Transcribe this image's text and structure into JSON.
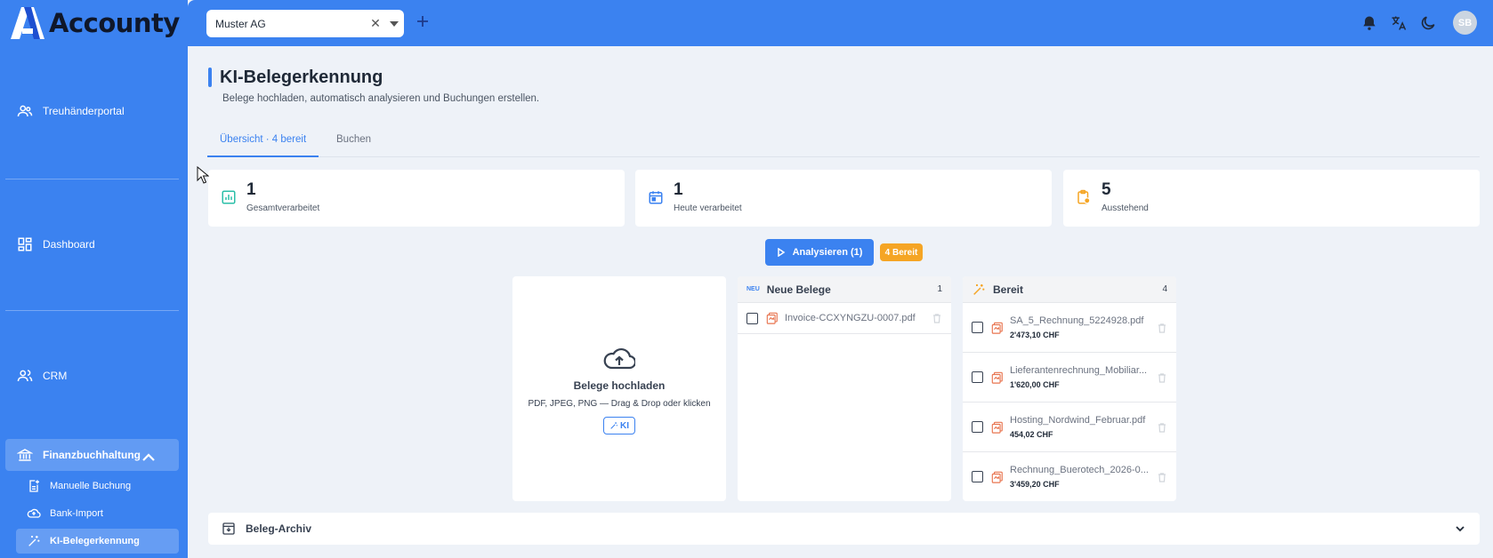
{
  "app": {
    "name": "Accounty"
  },
  "colors": {
    "primary": "#3b82f0",
    "accent_orange": "#f5a524",
    "file_icon": "#e8744f"
  },
  "sidebar": {
    "items": [
      {
        "label": "Treuhänderportal",
        "icon": "users-icon"
      },
      {
        "label": "Dashboard",
        "icon": "grid-icon"
      },
      {
        "label": "CRM",
        "icon": "contacts-icon"
      },
      {
        "label": "Finanzbuchhaltung",
        "icon": "bank-icon",
        "expanded": true
      }
    ],
    "subitems": [
      {
        "label": "Manuelle Buchung",
        "icon": "document-add-icon"
      },
      {
        "label": "Bank-Import",
        "icon": "cloud-upload-icon"
      },
      {
        "label": "KI-Belegerkennung",
        "icon": "magic-wand-icon",
        "active": true
      }
    ]
  },
  "topbar": {
    "company_select": {
      "value": "Muster AG"
    },
    "avatar_initials": "SB"
  },
  "page": {
    "title": "KI-Belegerkennung",
    "subtitle": "Belege hochladen, automatisch analysieren und Buchungen erstellen.",
    "tabs": [
      {
        "label": "Übersicht · 4 bereit",
        "active": true
      },
      {
        "label": "Buchen",
        "active": false
      }
    ]
  },
  "stats": [
    {
      "value": "1",
      "label": "Gesamtverarbeitet",
      "icon": "chart-icon"
    },
    {
      "value": "1",
      "label": "Heute verarbeitet",
      "icon": "calendar-icon"
    },
    {
      "value": "5",
      "label": "Ausstehend",
      "icon": "clipboard-pending-icon"
    }
  ],
  "actions": {
    "analyze_label": "Analysieren (1)",
    "ready_badge": "4 Bereit"
  },
  "upload": {
    "title": "Belege hochladen",
    "hint": "PDF, JPEG, PNG — Drag & Drop oder klicken",
    "chip": "KI"
  },
  "new_docs": {
    "tag": "NEU",
    "title": "Neue Belege",
    "count": "1",
    "files": [
      {
        "name": "Invoice-CCXYNGZU-0007.pdf"
      }
    ]
  },
  "ready_docs": {
    "title": "Bereit",
    "count": "4",
    "files": [
      {
        "name": "SA_5_Rechnung_5224928.pdf",
        "amount": "2'473,10 CHF"
      },
      {
        "name": "Lieferantenrechnung_Mobiliar...",
        "amount": "1'620,00 CHF"
      },
      {
        "name": "Hosting_Nordwind_Februar.pdf",
        "amount": "454,02 CHF"
      },
      {
        "name": "Rechnung_Buerotech_2026-0...",
        "amount": "3'459,20 CHF"
      }
    ]
  },
  "archive": {
    "label": "Beleg-Archiv"
  }
}
